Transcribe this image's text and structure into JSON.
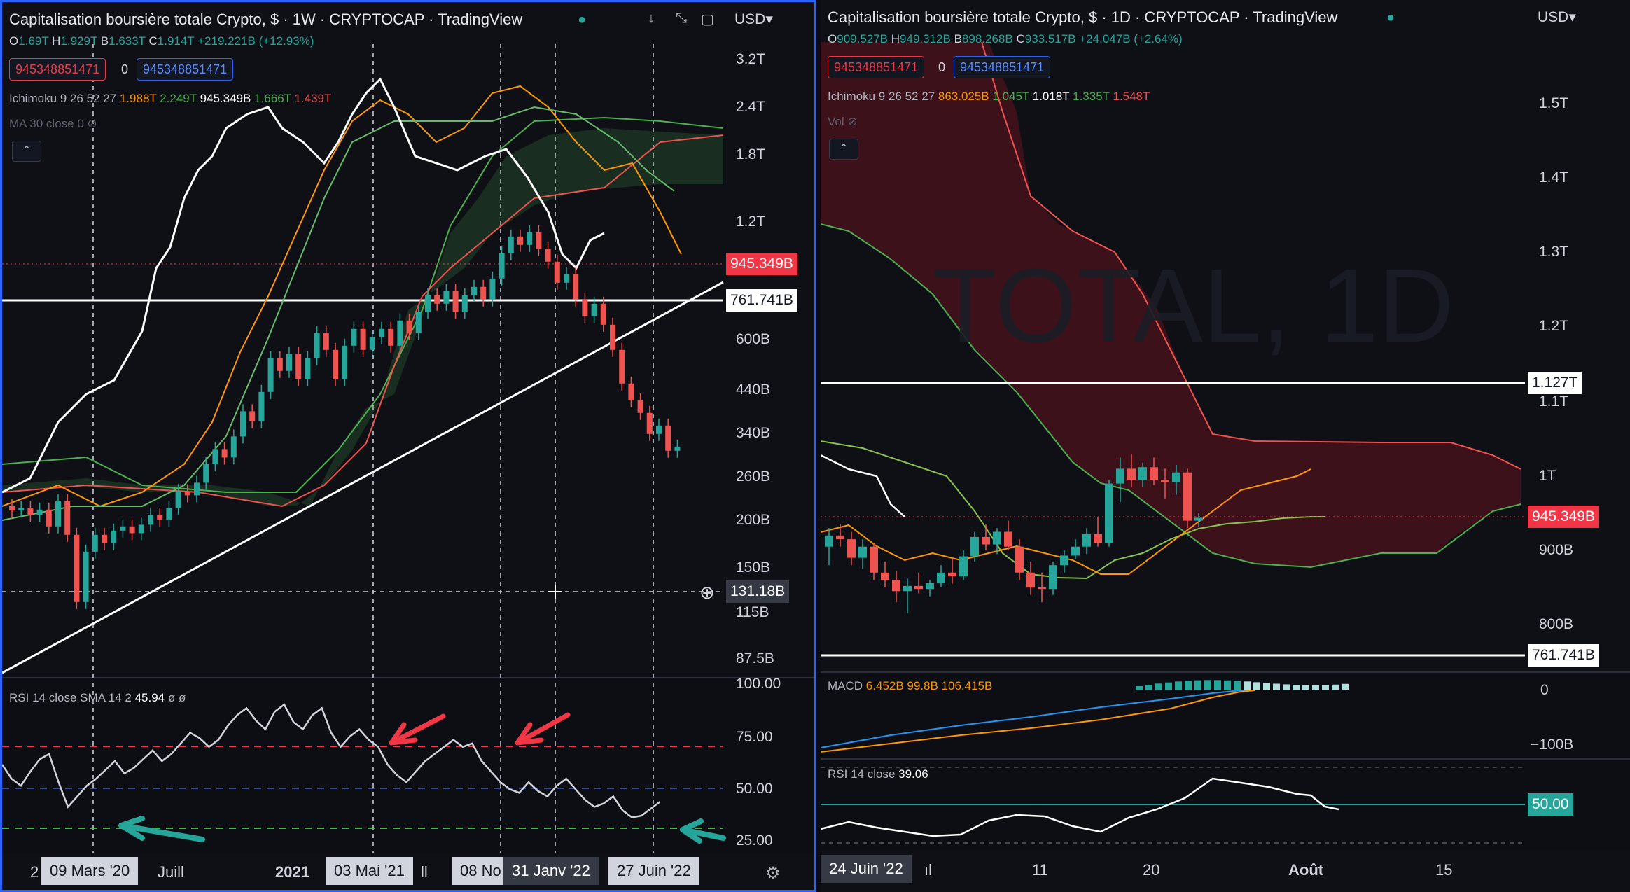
{
  "left": {
    "title": "Capitalisation boursière totale Crypto, $ · 1W · CRYPTOCAP · TradingView",
    "currency": "USD",
    "ohlc": {
      "o": "1.69T",
      "h": "1.929T",
      "b": "1.633T",
      "c": "1.914T",
      "chg": "+219.221B (+12.93%)"
    },
    "order_sell": "945348851471",
    "order_qty": "0",
    "order_buy": "945348851471",
    "ichimoku": {
      "name": "Ichimoku",
      "params": "9 26 52 27",
      "v1": "1.988T",
      "v2": "2.249T",
      "v3": "945.349B",
      "v4": "1.666T",
      "v5": "1.439T"
    },
    "ma": {
      "name": "MA 30 close 0"
    },
    "price_axis": [
      "3.2T",
      "2.4T",
      "1.8T",
      "1.2T",
      "600B",
      "440B",
      "340B",
      "260B",
      "200B",
      "150B",
      "115B",
      "87.5B"
    ],
    "last_price": "945.349B",
    "hline_price": "761.741B",
    "crosshair_price": "131.18B",
    "rsi": {
      "name": "RSI",
      "params": "14 close SMA 14 2",
      "value": "45.94",
      "extra": "ø ø"
    },
    "rsi_axis": [
      "100.00",
      "75.00",
      "50.00",
      "25.00"
    ],
    "time_axis": [
      "2",
      "Juill",
      "2021",
      "ll",
      "08 No"
    ],
    "date_labels": [
      "09 Mars '20",
      "03 Mai '21",
      "31 Janv '22",
      "27 Juin '22"
    ],
    "rsi_values": [
      60,
      52,
      48,
      56,
      63,
      66,
      50,
      36,
      42,
      48,
      52,
      57,
      62,
      55,
      58,
      63,
      68,
      62,
      66,
      72,
      78,
      75,
      70,
      74,
      82,
      88,
      92,
      85,
      80,
      90,
      94,
      84,
      80,
      88,
      92,
      78,
      70,
      76,
      80,
      74,
      70,
      60,
      54,
      50,
      56,
      62,
      66,
      70,
      74,
      70,
      72,
      62,
      56,
      50,
      46,
      44,
      50,
      45,
      42,
      48,
      52,
      46,
      40,
      36,
      38,
      42,
      34,
      30,
      31,
      35,
      39
    ]
  },
  "right": {
    "title": "Capitalisation boursière totale Crypto, $ · 1D · CRYPTOCAP · TradingView",
    "currency": "USD",
    "ohlc": {
      "o": "909.527B",
      "h": "949.312B",
      "b": "898.268B",
      "c": "933.517B",
      "chg": "+24.047B (+2.64%)"
    },
    "order_sell": "945348851471",
    "order_qty": "0",
    "order_buy": "945348851471",
    "ichimoku": {
      "name": "Ichimoku",
      "params": "9 26 52 27",
      "v1": "863.025B",
      "v2": "1.045T",
      "v3": "1.018T",
      "v4": "1.335T",
      "v5": "1.548T"
    },
    "vol": "Vol",
    "price_axis": [
      "1.5T",
      "1.4T",
      "1.3T",
      "1.2T",
      "1.1T",
      "1T",
      "900B",
      "800B"
    ],
    "hline_upper": "1.127T",
    "last_price": "945.349B",
    "hline_lower": "761.741B",
    "macd": {
      "name": "MACD",
      "values": "6.452B   99.8B   106.415B"
    },
    "macd_axis": [
      "0",
      "−100B"
    ],
    "rsi": {
      "name": "RSI",
      "params": "14 close",
      "value": "39.06"
    },
    "rsi_level": "50.00",
    "date_label": "24 Juin '22",
    "time_axis": [
      "ıl",
      "11",
      "20",
      "Août",
      "15"
    ],
    "watermark": "TOTAL, 1D",
    "candles": [
      [
        905,
        930,
        880,
        920
      ],
      [
        920,
        935,
        905,
        915
      ],
      [
        915,
        925,
        880,
        890
      ],
      [
        890,
        915,
        875,
        905
      ],
      [
        905,
        910,
        860,
        870
      ],
      [
        870,
        885,
        850,
        860
      ],
      [
        860,
        872,
        830,
        845
      ],
      [
        845,
        862,
        815,
        852
      ],
      [
        852,
        870,
        842,
        848
      ],
      [
        848,
        860,
        838,
        856
      ],
      [
        856,
        880,
        850,
        870
      ],
      [
        870,
        890,
        855,
        865
      ],
      [
        865,
        900,
        860,
        892
      ],
      [
        892,
        925,
        885,
        918
      ],
      [
        918,
        935,
        900,
        908
      ],
      [
        908,
        930,
        895,
        925
      ],
      [
        925,
        940,
        900,
        905
      ],
      [
        905,
        915,
        860,
        870
      ],
      [
        870,
        885,
        840,
        850
      ],
      [
        850,
        870,
        830,
        848
      ],
      [
        848,
        885,
        840,
        880
      ],
      [
        880,
        900,
        870,
        893
      ],
      [
        893,
        915,
        888,
        905
      ],
      [
        905,
        930,
        895,
        922
      ],
      [
        922,
        945,
        905,
        910
      ],
      [
        910,
        995,
        905,
        990
      ],
      [
        990,
        1025,
        965,
        1010
      ],
      [
        1010,
        1030,
        985,
        995
      ],
      [
        995,
        1018,
        985,
        1012
      ],
      [
        1012,
        1025,
        988,
        995
      ],
      [
        995,
        1010,
        970,
        992
      ],
      [
        992,
        1015,
        975,
        1005
      ],
      [
        1005,
        1010,
        930,
        940
      ],
      [
        940,
        950,
        932,
        944
      ]
    ]
  }
}
